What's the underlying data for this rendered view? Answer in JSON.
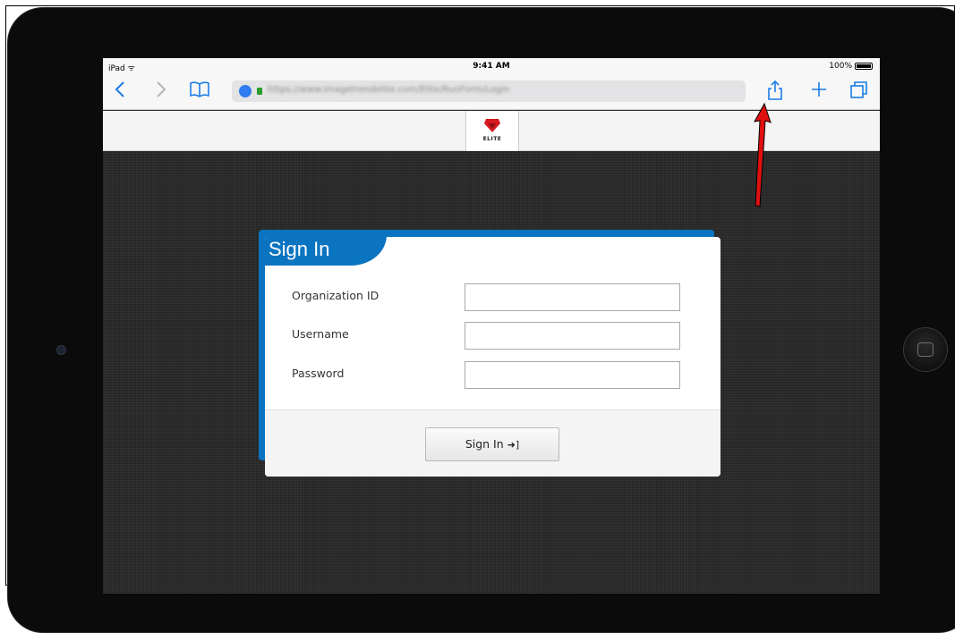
{
  "status_bar": {
    "device": "iPad",
    "time": "9:41 AM",
    "battery": "100%"
  },
  "browser": {
    "url": "https://www.imagetrendelite.com/Elite/RunForm/Login",
    "icons": {
      "back": "chevron-left-icon",
      "forward": "chevron-right-icon",
      "bookmarks": "book-icon",
      "share": "share-icon",
      "new_tab": "plus-icon",
      "tabs": "tabs-icon"
    }
  },
  "header": {
    "logo_text": "ELITE",
    "logo_color": "#d71920"
  },
  "signin": {
    "title": "Sign In",
    "accent_color": "#0a74c1",
    "fields": [
      {
        "label": "Organization ID",
        "value": ""
      },
      {
        "label": "Username",
        "value": ""
      },
      {
        "label": "Password",
        "value": ""
      }
    ],
    "button_label": "Sign In"
  },
  "annotation": {
    "arrow_color": "#e01010"
  }
}
